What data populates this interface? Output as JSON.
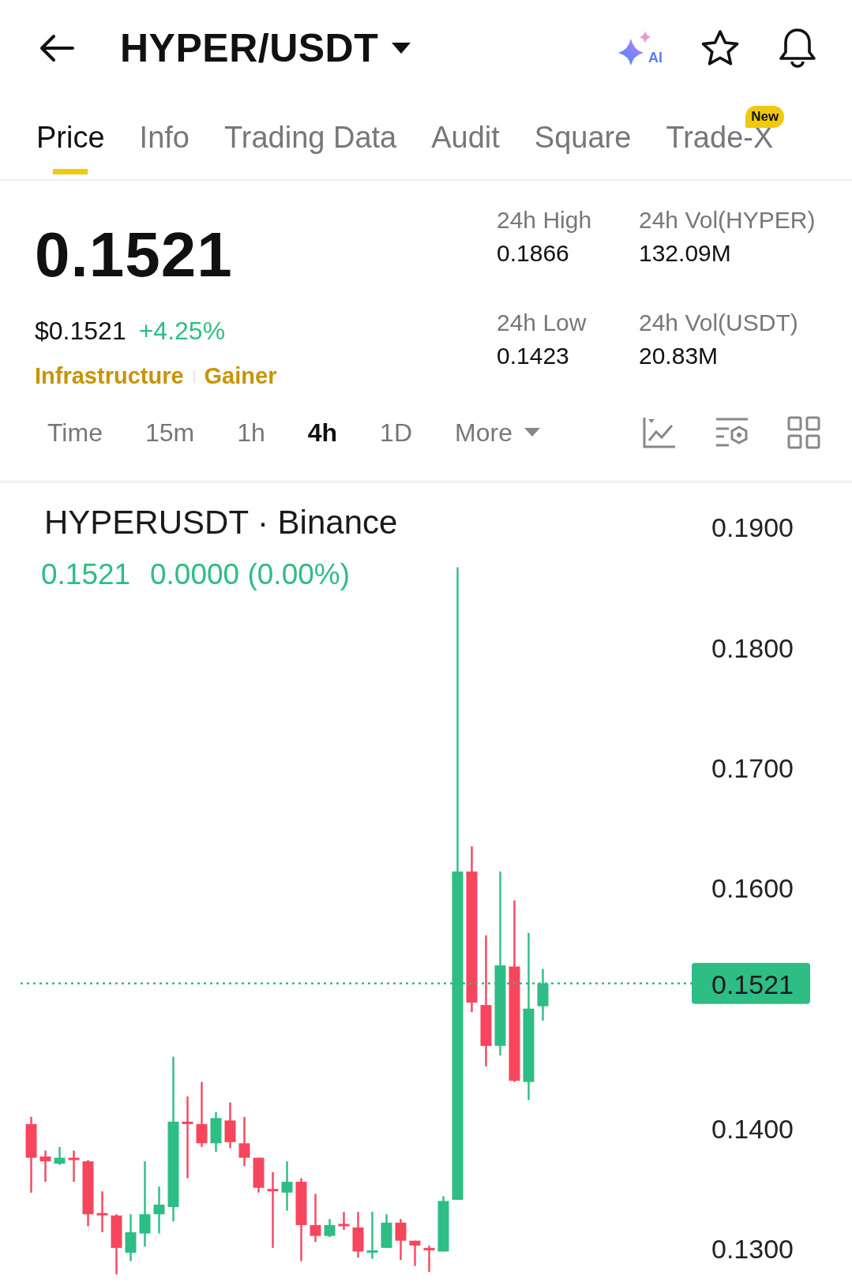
{
  "header": {
    "title": "HYPER/USDT",
    "ai_label": "AI"
  },
  "tabs": [
    {
      "label": "Price",
      "selected": true
    },
    {
      "label": "Info",
      "selected": false
    },
    {
      "label": "Trading Data",
      "selected": false
    },
    {
      "label": "Audit",
      "selected": false
    },
    {
      "label": "Square",
      "selected": false
    },
    {
      "label": "Trade-X",
      "selected": false,
      "badge": "New"
    }
  ],
  "summary": {
    "price": "0.1521",
    "price_usd": "$0.1521",
    "change": "+4.25%",
    "tags": [
      "Infrastructure",
      "Gainer"
    ],
    "stats": [
      {
        "label": "24h High",
        "value": "0.1866"
      },
      {
        "label": "24h Vol(HYPER)",
        "value": "132.09M"
      },
      {
        "label": "24h Low",
        "value": "0.1423"
      },
      {
        "label": "24h Vol(USDT)",
        "value": "20.83M"
      }
    ]
  },
  "intervals": [
    {
      "label": "Time",
      "selected": false,
      "kind": "option"
    },
    {
      "label": "15m",
      "selected": false,
      "kind": "option"
    },
    {
      "label": "1h",
      "selected": false,
      "kind": "option"
    },
    {
      "label": "4h",
      "selected": true,
      "kind": "option"
    },
    {
      "label": "1D",
      "selected": false,
      "kind": "option"
    },
    {
      "label": "More",
      "selected": false,
      "kind": "dropdown"
    }
  ],
  "chart": {
    "title": "HYPERUSDT · Binance",
    "last": "0.1521",
    "change": "0.0000 (0.00%)",
    "price_axis": [
      "0.1900",
      "0.1800",
      "0.1700",
      "0.1600",
      "0.1400",
      "0.1300"
    ],
    "current_price": "0.1521"
  }
}
